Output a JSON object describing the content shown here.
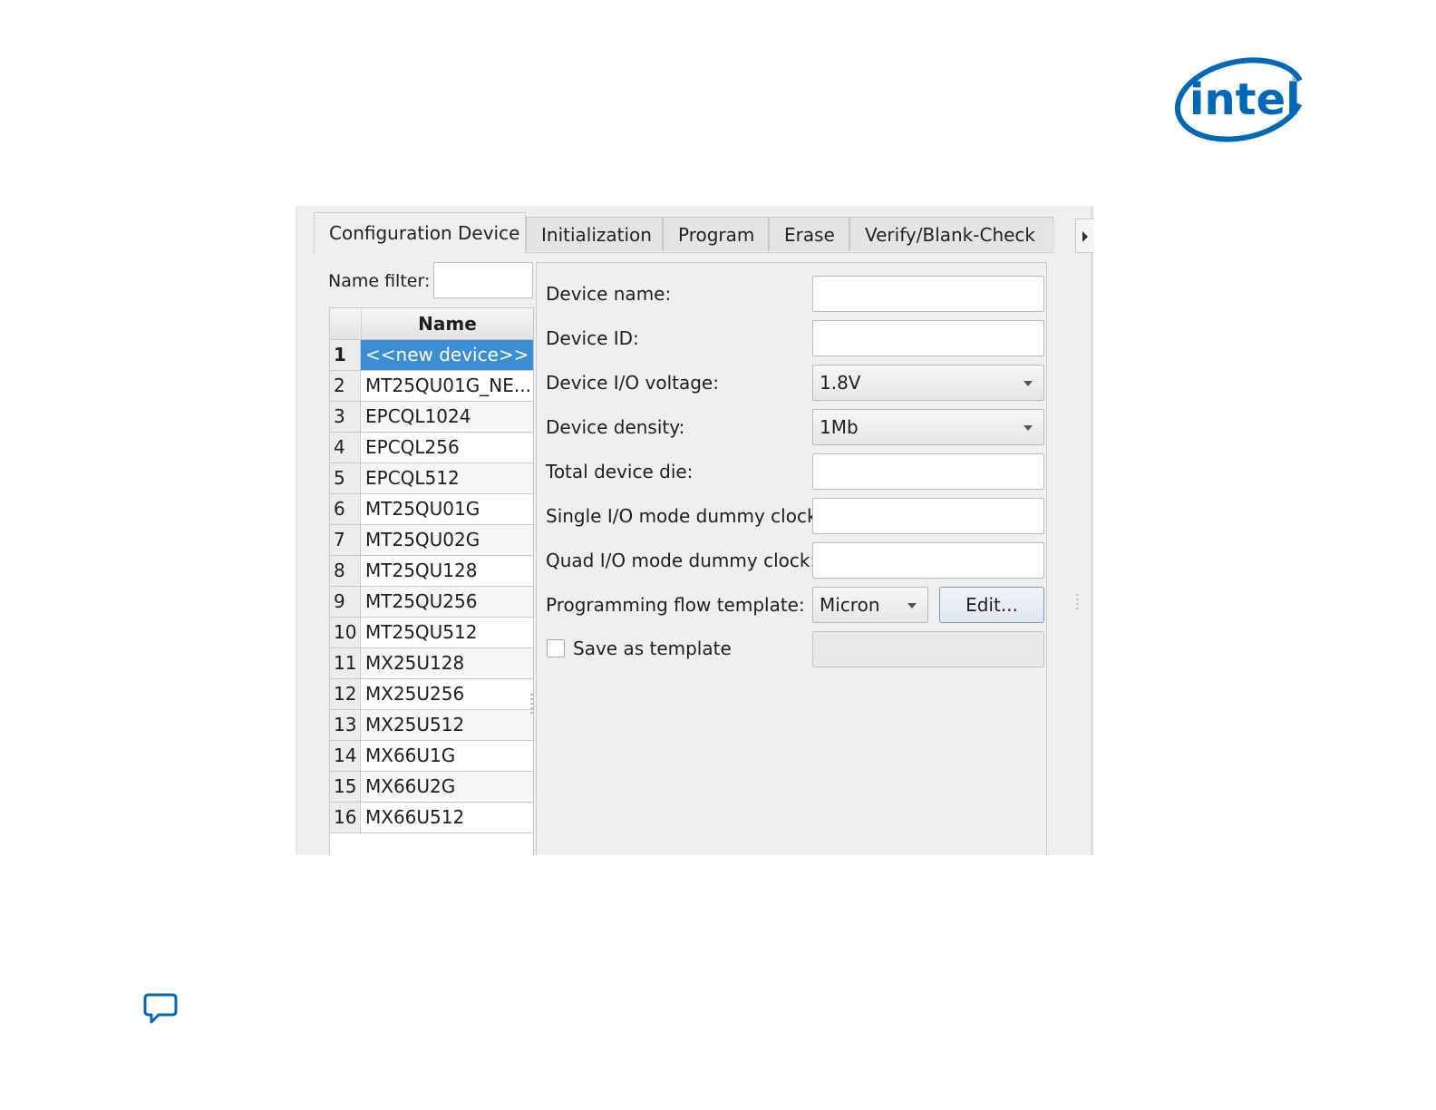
{
  "brand": {
    "logo_text": "intel",
    "color": "#0068b5"
  },
  "tabs": [
    {
      "label": "Configuration Device",
      "active": true
    },
    {
      "label": "Initialization",
      "active": false
    },
    {
      "label": "Program",
      "active": false
    },
    {
      "label": "Erase",
      "active": false
    },
    {
      "label": "Verify/Blank-Check",
      "active": false
    }
  ],
  "filter": {
    "label": "Name filter:",
    "value": ""
  },
  "device_table": {
    "header": "Name",
    "rows": [
      {
        "num": "1",
        "name": "<<new device>>",
        "selected": true
      },
      {
        "num": "2",
        "name": "MT25QU01G_NE..."
      },
      {
        "num": "3",
        "name": "EPCQL1024"
      },
      {
        "num": "4",
        "name": "EPCQL256"
      },
      {
        "num": "5",
        "name": "EPCQL512"
      },
      {
        "num": "6",
        "name": "MT25QU01G"
      },
      {
        "num": "7",
        "name": "MT25QU02G"
      },
      {
        "num": "8",
        "name": "MT25QU128"
      },
      {
        "num": "9",
        "name": "MT25QU256"
      },
      {
        "num": "10",
        "name": "MT25QU512"
      },
      {
        "num": "11",
        "name": "MX25U128"
      },
      {
        "num": "12",
        "name": "MX25U256"
      },
      {
        "num": "13",
        "name": "MX25U512"
      },
      {
        "num": "14",
        "name": "MX66U1G"
      },
      {
        "num": "15",
        "name": "MX66U2G"
      },
      {
        "num": "16",
        "name": "MX66U512"
      }
    ]
  },
  "form": {
    "device_name": {
      "label": "Device name:",
      "value": ""
    },
    "device_id": {
      "label": "Device ID:",
      "value": ""
    },
    "io_voltage": {
      "label": "Device I/O voltage:",
      "value": "1.8V"
    },
    "density": {
      "label": "Device density:",
      "value": "1Mb"
    },
    "total_die": {
      "label": "Total device die:",
      "value": ""
    },
    "single_io_dummy": {
      "label": "Single I/O mode dummy clock:",
      "value": ""
    },
    "quad_io_dummy": {
      "label": "Quad I/O mode dummy clock:",
      "value": ""
    },
    "flow_template": {
      "label": "Programming flow template:",
      "value": "Micron",
      "edit_label": "Edit..."
    },
    "save_template": {
      "label": "Save as template",
      "checked": false,
      "name_value": ""
    }
  },
  "colors": {
    "selection": "#3c8ed4",
    "feedback_icon": "#0068b5"
  },
  "icons": {
    "feedback": "speech-bubble-icon",
    "tab_scroll": "arrow-right-icon"
  }
}
